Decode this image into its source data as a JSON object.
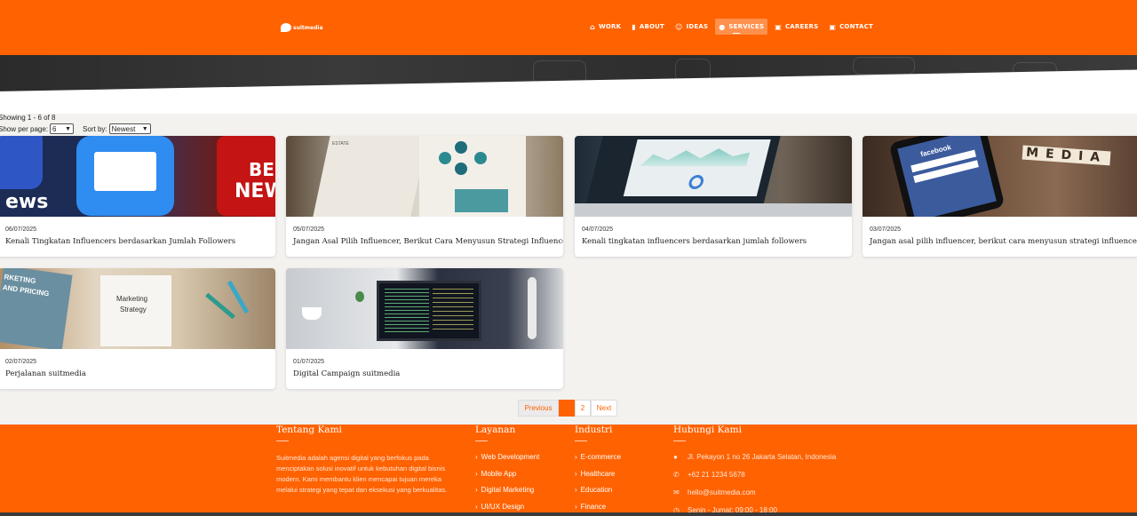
{
  "brand": {
    "logo_text": "suitmedia"
  },
  "nav": [
    {
      "icon": "⌂",
      "icon_name": "home-icon",
      "label": "WORK",
      "active": false
    },
    {
      "icon": "▮",
      "icon_name": "book-icon",
      "label": "ABOUT",
      "active": false
    },
    {
      "icon": "☺",
      "icon_name": "users-icon",
      "label": "IDEAS",
      "active": false
    },
    {
      "icon": "●",
      "icon_name": "location-pin-icon",
      "label": "SERVICES",
      "active": true
    },
    {
      "icon": "▣",
      "icon_name": "briefcase-icon",
      "label": "CAREERS",
      "active": false
    },
    {
      "icon": "▣",
      "icon_name": "contact-card-icon",
      "label": "CONTACT",
      "active": false
    }
  ],
  "listing": {
    "showing": "Showing 1 - 6 of 8",
    "per_page_label": "Show per page:",
    "per_page_value": "6",
    "sort_label": "Sort by:",
    "sort_value": "Newest"
  },
  "posts": [
    {
      "date": "06/07/2025",
      "title": "Kenali Tingkatan Influencers berdasarkan Jumlah Followers"
    },
    {
      "date": "05/07/2025",
      "title": "Jangan Asal Pilih Influencer, Berikut Cara Menyusun Strategi Influencer"
    },
    {
      "date": "04/07/2025",
      "title": "Kenali tingkatan influencers berdasarkan jumlah followers"
    },
    {
      "date": "03/07/2025",
      "title": "Jangan asal pilih influencer, berikut cara menyusun strategi influencer"
    },
    {
      "date": "02/07/2025",
      "title": "Perjalanan suitmedia"
    },
    {
      "date": "01/07/2025",
      "title": "Digital Campaign suitmedia"
    }
  ],
  "thumb_text": {
    "t1": [
      "ews",
      "BE",
      "NEW"
    ],
    "t2": [
      "ESTATE"
    ],
    "t4": [
      "facebook",
      "MEDIA"
    ],
    "t5": [
      "RKETING",
      "AND PRICING",
      "Marketing",
      "Strategy"
    ]
  },
  "pagination": {
    "previous": "Previous",
    "current": "1",
    "page2": "2",
    "next": "Next"
  },
  "footer": {
    "about_title": "Tentang Kami",
    "about_text": "Suitmedia adalah agensi digital yang berfokus pada menciptakan solusi inovatif untuk kebutuhan digital bisnis modern. Kami membantu klien mencapai tujuan mereka melalui strategi yang tepat dan eksekusi yang berkualitas.",
    "services_title": "Layanan",
    "services": [
      "Web Development",
      "Mobile App",
      "Digital Marketing",
      "UI/UX Design"
    ],
    "industry_title": "Industri",
    "industries": [
      "E-commerce",
      "Healthcare",
      "Education",
      "Finance"
    ],
    "contact_title": "Hubungi Kami",
    "contacts": [
      {
        "icon": "●",
        "icon_name": "location-icon",
        "text": "Jl. Pekayon 1 no 26 Jakarta Selatan, Indonesia"
      },
      {
        "icon": "✆",
        "icon_name": "phone-icon",
        "text": "+62 21 1234 5678"
      },
      {
        "icon": "✉",
        "icon_name": "email-icon",
        "text": "hello@suitmedia.com"
      },
      {
        "icon": "◷",
        "icon_name": "clock-icon",
        "text": "Senin - Jumat: 09:00 - 18:00"
      }
    ]
  },
  "colors": {
    "brand_orange": "#ff6200",
    "page_bg": "#f3f2ef"
  }
}
